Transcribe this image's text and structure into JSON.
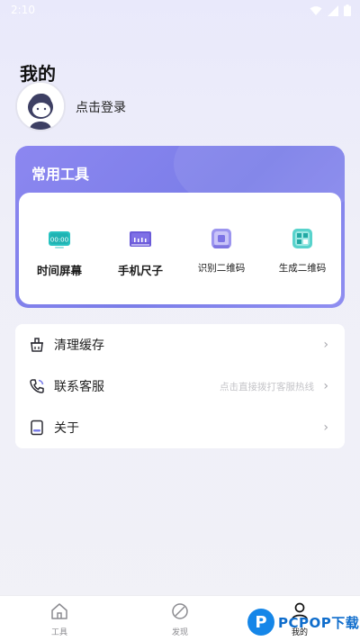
{
  "status_bar": {
    "time": "2:10"
  },
  "profile": {
    "page_title": "我的",
    "login_text": "点击登录"
  },
  "tools": {
    "title": "常用工具",
    "items": [
      {
        "label": "时间屏幕",
        "icon": "clock-screen-icon",
        "clock_text": "00:00"
      },
      {
        "label": "手机尺子",
        "icon": "ruler-icon"
      },
      {
        "label": "识别二维码",
        "icon": "scan-qr-icon"
      },
      {
        "label": "生成二维码",
        "icon": "generate-qr-icon"
      }
    ]
  },
  "menu": {
    "items": [
      {
        "label": "清理缓存",
        "icon": "broom-icon",
        "hint": ""
      },
      {
        "label": "联系客服",
        "icon": "phone-icon",
        "hint": "点击直接拨打客服热线"
      },
      {
        "label": "关于",
        "icon": "info-icon",
        "hint": ""
      }
    ]
  },
  "tabbar": {
    "tabs": [
      {
        "label": "工具",
        "icon": "home-icon",
        "active": false
      },
      {
        "label": "发现",
        "icon": "leaf-icon",
        "active": false
      },
      {
        "label": "我的",
        "icon": "user-icon",
        "active": true
      }
    ]
  },
  "watermark": {
    "logo_letter": "P",
    "text": "PCPOP下载"
  },
  "colors": {
    "accent": "#7a7de8",
    "tab_active": "#111111",
    "tab_inactive": "#8b8b90"
  }
}
